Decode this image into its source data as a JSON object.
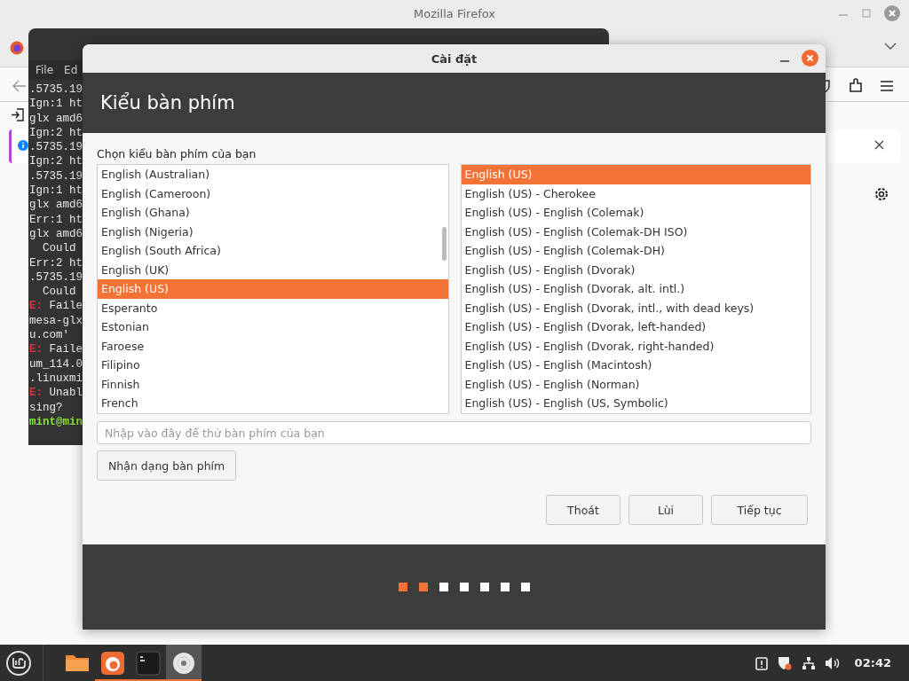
{
  "firefox_window": {
    "title": "Mozilla Firefox"
  },
  "terminal_window": {
    "menu": [
      "File",
      "Ed"
    ],
    "lines": [
      {
        "kind": "plain",
        "text": ".5735.19"
      },
      {
        "kind": "plain",
        "text": "Ign:1 ht"
      },
      {
        "kind": "plain",
        "text": "glx amd6"
      },
      {
        "kind": "plain",
        "text": "Ign:2 ht"
      },
      {
        "kind": "plain",
        "text": ".5735.19"
      },
      {
        "kind": "plain",
        "text": "Ign:2 ht"
      },
      {
        "kind": "plain",
        "text": ".5735.19"
      },
      {
        "kind": "plain",
        "text": "Ign:1 ht"
      },
      {
        "kind": "plain",
        "text": "glx amd6"
      },
      {
        "kind": "plain",
        "text": "Err:1 ht"
      },
      {
        "kind": "plain",
        "text": "glx amd6"
      },
      {
        "kind": "plain",
        "text": "  Could"
      },
      {
        "kind": "plain",
        "text": "Err:2 ht"
      },
      {
        "kind": "plain",
        "text": ".5735.19"
      },
      {
        "kind": "plain",
        "text": "  Could"
      },
      {
        "kind": "error",
        "prefix": "E:",
        "text": "Faile"
      },
      {
        "kind": "plain",
        "text": "mesa-glx"
      },
      {
        "kind": "plain",
        "text": "u.com'"
      },
      {
        "kind": "error",
        "prefix": "E:",
        "text": "Faile"
      },
      {
        "kind": "plain",
        "text": "um_114.0"
      },
      {
        "kind": "plain",
        "text": ".linuxmi"
      },
      {
        "kind": "error",
        "prefix": "E:",
        "text": "Unabl"
      },
      {
        "kind": "plain",
        "text": "sing?"
      },
      {
        "kind": "prompt",
        "text": "mint@min"
      }
    ]
  },
  "dialog": {
    "title": "Cài đặt",
    "heading": "Kiểu bàn phím",
    "prompt": "Chọn kiểu bàn phím của bạn",
    "layouts": [
      {
        "label": "English (Australian)",
        "selected": false
      },
      {
        "label": "English (Cameroon)",
        "selected": false
      },
      {
        "label": "English (Ghana)",
        "selected": false
      },
      {
        "label": "English (Nigeria)",
        "selected": false
      },
      {
        "label": "English (South Africa)",
        "selected": false
      },
      {
        "label": "English (UK)",
        "selected": false
      },
      {
        "label": "English (US)",
        "selected": true
      },
      {
        "label": "Esperanto",
        "selected": false
      },
      {
        "label": "Estonian",
        "selected": false
      },
      {
        "label": "Faroese",
        "selected": false
      },
      {
        "label": "Filipino",
        "selected": false
      },
      {
        "label": "Finnish",
        "selected": false
      },
      {
        "label": "French",
        "selected": false
      }
    ],
    "variants": [
      {
        "label": "English (US)",
        "selected": true
      },
      {
        "label": "English (US) - Cherokee",
        "selected": false
      },
      {
        "label": "English (US) - English (Colemak)",
        "selected": false
      },
      {
        "label": "English (US) - English (Colemak-DH ISO)",
        "selected": false
      },
      {
        "label": "English (US) - English (Colemak-DH)",
        "selected": false
      },
      {
        "label": "English (US) - English (Dvorak)",
        "selected": false
      },
      {
        "label": "English (US) - English (Dvorak, alt. intl.)",
        "selected": false
      },
      {
        "label": "English (US) - English (Dvorak, intl., with dead keys)",
        "selected": false
      },
      {
        "label": "English (US) - English (Dvorak, left-handed)",
        "selected": false
      },
      {
        "label": "English (US) - English (Dvorak, right-handed)",
        "selected": false
      },
      {
        "label": "English (US) - English (Macintosh)",
        "selected": false
      },
      {
        "label": "English (US) - English (Norman)",
        "selected": false
      },
      {
        "label": "English (US) - English (US, Symbolic)",
        "selected": false
      }
    ],
    "test_field": {
      "placeholder": "Nhập vào đây để thử bàn phím của bạn"
    },
    "detect_button": "Nhận dạng bàn phím",
    "buttons": [
      "Thoát",
      "Lùi",
      "Tiếp tục"
    ],
    "steps": [
      {
        "done": true
      },
      {
        "done": true
      },
      {
        "done": false
      },
      {
        "done": false
      },
      {
        "done": false
      },
      {
        "done": false
      },
      {
        "done": false
      }
    ]
  },
  "taskbar": {
    "apps": [
      {
        "kind": "folder",
        "running": false,
        "selected": false
      },
      {
        "kind": "firefox",
        "running": true,
        "selected": false
      },
      {
        "kind": "terminal",
        "running": true,
        "selected": false
      },
      {
        "kind": "disc",
        "running": true,
        "selected": true
      }
    ],
    "clock": "02:42"
  }
}
